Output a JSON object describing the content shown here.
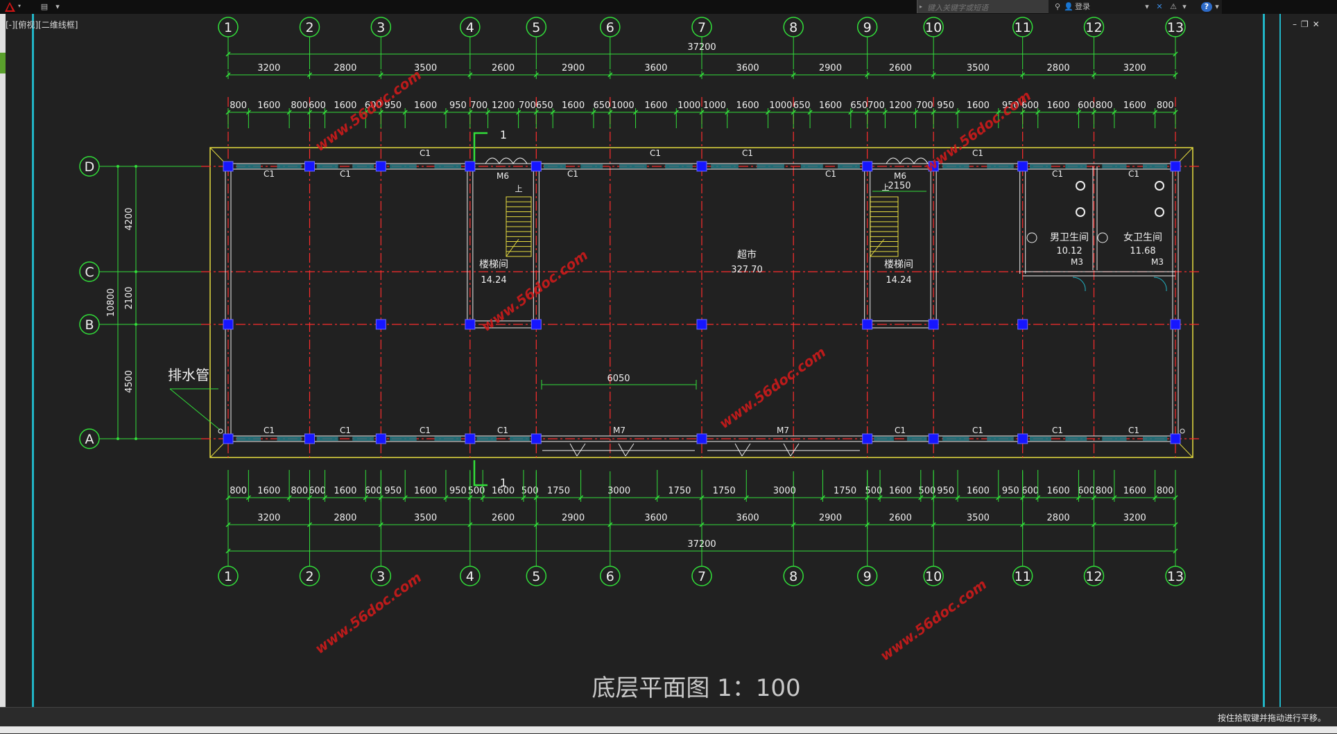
{
  "toolbar": {
    "search_placeholder": "键入关键字或短语",
    "login_label": "登录",
    "help_label": "?"
  },
  "viewport": {
    "label": "[-][俯视][二维线框]"
  },
  "status": {
    "hint": "按住拾取键并拖动进行平移。"
  },
  "drawing": {
    "title": "底层平面图 1：100",
    "col_labels": [
      "1",
      "2",
      "3",
      "4",
      "5",
      "6",
      "7",
      "8",
      "9",
      "10",
      "11",
      "12",
      "13"
    ],
    "row_labels": [
      "D",
      "C",
      "B",
      "A"
    ],
    "overall_dim": "37200",
    "bay_dims": [
      "3200",
      "2800",
      "3500",
      "2600",
      "2900",
      "3600",
      "3600",
      "2900",
      "2600",
      "3500",
      "2800",
      "3200"
    ],
    "top_detail_dims": [
      "800",
      "1600",
      "800",
      "600",
      "1600",
      "600",
      "950",
      "1600",
      "950",
      "700",
      "1200",
      "700",
      "650",
      "1600",
      "650",
      "1000",
      "1600",
      "1000",
      "1000",
      "1600",
      "1000",
      "650",
      "1600",
      "650",
      "700",
      "1200",
      "700",
      "950",
      "1600",
      "950",
      "600",
      "1600",
      "600",
      "800",
      "1600",
      "800"
    ],
    "bottom_detail_dims": [
      "800",
      "1600",
      "800",
      "600",
      "1600",
      "600",
      "950",
      "1600",
      "950",
      "500",
      "1600",
      "500",
      "1750",
      "3000",
      "1750",
      "1750",
      "3000",
      "1750",
      "500",
      "1600",
      "500",
      "950",
      "1600",
      "950",
      "600",
      "1600",
      "600",
      "800",
      "1600",
      "800"
    ],
    "left_dims": [
      "4200",
      "2100",
      "4500"
    ],
    "left_total": "10800",
    "rooms": [
      {
        "name": "楼梯间",
        "area": "14.24"
      },
      {
        "name": "超市",
        "area": "327.70"
      },
      {
        "name": "楼梯间",
        "area": "14.24"
      },
      {
        "name": "男卫生间",
        "area": "10.12"
      },
      {
        "name": "女卫生间",
        "area": "11.68"
      }
    ],
    "window_label": "C1",
    "door_m6": "M6",
    "door_m7": "M7",
    "door_m3": "M3",
    "stair_up": "上",
    "dim_6050": "6050",
    "dim_2150": "2150",
    "section_mark": "1",
    "drain_label": "排水管",
    "watermark": "www.56doc.com"
  },
  "colors": {
    "axis": "#ff2d2d",
    "dim": "#32e03a",
    "wall": "#f0f0f0",
    "column": "#1616ff",
    "outline": "#e6dc40",
    "cyan": "#21b5c6"
  }
}
